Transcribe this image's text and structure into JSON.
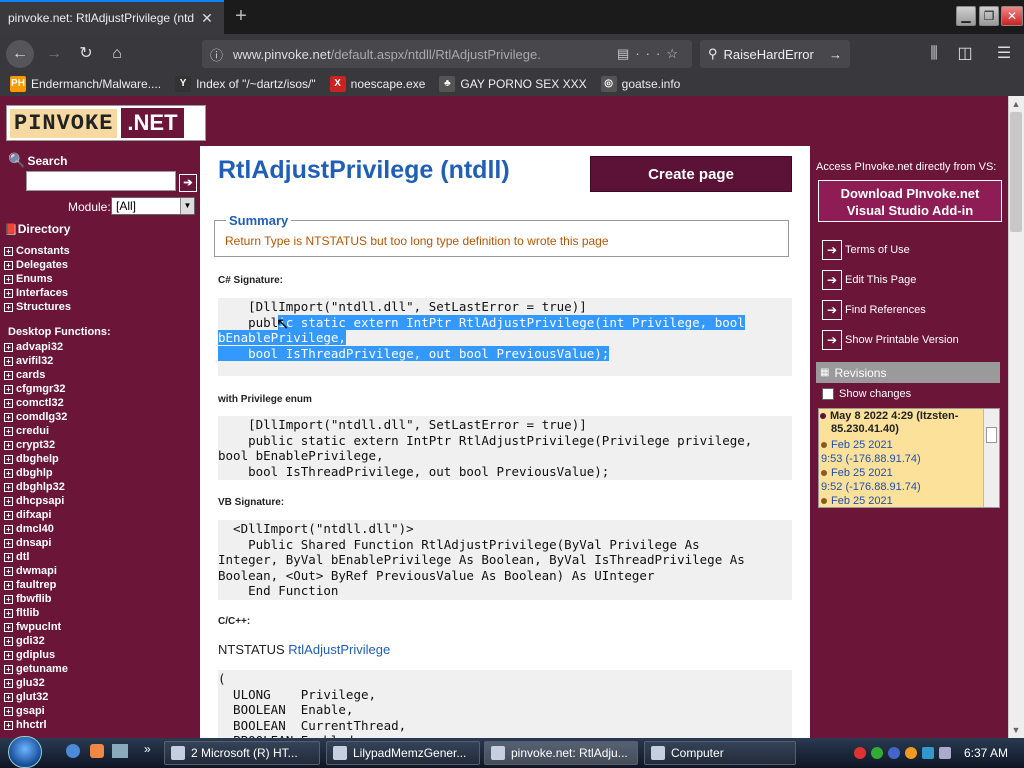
{
  "browser": {
    "tab_title": "pinvoke.net: RtlAdjustPrivilege (ntd",
    "tab_close": "✕",
    "new_tab": "+",
    "url_host": "www.pinvoke.net",
    "url_path": "/default.aspx/ntdll/RtlAdjustPrivilege.",
    "url_more": "···",
    "search_text": "RaiseHardError",
    "bookmarks": [
      {
        "label": "Endermanch/Malware....",
        "icon_text": "PH",
        "color": "#f90"
      },
      {
        "label": "Index of \"/~dartz/isos/\"",
        "icon_text": "Y",
        "color": "#333"
      },
      {
        "label": "noescape.exe",
        "icon_text": "X",
        "color": "#c22"
      },
      {
        "label": "GAY PORNO SEX XXX",
        "icon_text": "♣",
        "color": "#555"
      },
      {
        "label": "goatse.info",
        "icon_text": "◎",
        "color": "#555"
      }
    ]
  },
  "logo": {
    "left": "PINVOKE",
    "right": ".NET"
  },
  "sidebar": {
    "search_label": "Search",
    "search_go": "➔",
    "module_label": "Module:",
    "module_value": "[All]",
    "directory_label": "Directory",
    "dir_items": [
      "Constants",
      "Delegates",
      "Enums",
      "Interfaces",
      "Structures"
    ],
    "desktop_label": "Desktop Functions:",
    "modules": [
      "advapi32",
      "avifil32",
      "cards",
      "cfgmgr32",
      "comctl32",
      "comdlg32",
      "credui",
      "crypt32",
      "dbghelp",
      "dbghlp",
      "dbghlp32",
      "dhcpsapi",
      "difxapi",
      "dmcl40",
      "dnsapi",
      "dtl",
      "dwmapi",
      "faultrep",
      "fbwflib",
      "fltlib",
      "fwpuclnt",
      "gdi32",
      "gdiplus",
      "getuname",
      "glu32",
      "glut32",
      "gsapi",
      "hhctrl"
    ]
  },
  "main": {
    "title": "RtlAdjustPrivilege (ntdll)",
    "create_page": "Create page",
    "summary_legend": "Summary",
    "summary_text": "Return Type is NTSTATUS but too long type definition to wrote this page",
    "cs_sig_label": "C# Signature:",
    "cs_sig_l1": "    [DllImport(\"ntdll.dll\", SetLastError = true)]",
    "cs_sig_l2a": "    publ",
    "cs_sig_l2b": "ic static extern IntPtr RtlAdjustPrivilege(int Privilege, bool",
    "cs_sig_l3": "bEnablePrivilege,",
    "cs_sig_l4": "    bool IsThreadPrivilege, out bool PreviousValue);",
    "enum_label": "with Privilege enum",
    "enum_code": "    [DllImport(\"ntdll.dll\", SetLastError = true)]\n    public static extern IntPtr RtlAdjustPrivilege(Privilege privilege,\nbool bEnablePrivilege,\n    bool IsThreadPrivilege, out bool PreviousValue);",
    "vb_label": "VB Signature:",
    "vb_code": "  <DllImport(\"ntdll.dll\")>\n    Public Shared Function RtlAdjustPrivilege(ByVal Privilege As\nInteger, ByVal bEnablePrivilege As Boolean, ByVal IsThreadPrivilege As\nBoolean, <Out> ByRef PreviousValue As Boolean) As UInteger\n    End Function",
    "cpp_label": "C/C++:",
    "cpp_type": "NTSTATUS ",
    "cpp_link": "RtlAdjustPrivilege",
    "cpp_code": "(\n  ULONG    Privilege,\n  BOOLEAN  Enable,\n  BOOLEAN  CurrentThread,\n  PBOOLEAN Enabled"
  },
  "right": {
    "access_text": "Access PInvoke.net directly from VS:",
    "addin_line1": "Download PInvoke.net",
    "addin_line2": "Visual Studio Add-in",
    "links": [
      "Terms of Use",
      "Edit This Page",
      "Find References",
      "Show Printable Version"
    ],
    "revisions_label": "Revisions",
    "show_changes": "Show changes",
    "rev_top": "May 8 2022 4:29  (Itzsten-",
    "rev_top2": "85.230.41.40)",
    "rev_items": [
      {
        "date": "Feb 25 2021",
        "detail": "9:53  (-176.88.91.74)"
      },
      {
        "date": "Feb 25 2021",
        "detail": "9:52  (-176.88.91.74)"
      },
      {
        "date": "Feb 25 2021",
        "detail": ""
      }
    ]
  },
  "taskbar": {
    "buttons": [
      "2 Microsoft (R) HT...",
      "LilypadMemzGener...",
      "pinvoke.net: RtlAdju...",
      "Computer"
    ],
    "clock": "6:37 AM"
  }
}
